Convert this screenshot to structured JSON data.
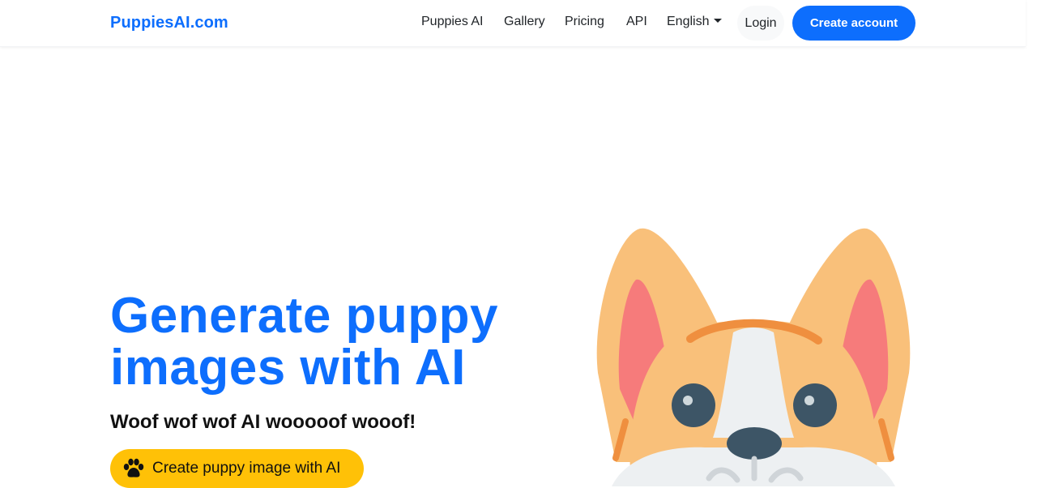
{
  "navbar": {
    "brand": "PuppiesAI.com",
    "links": [
      "Puppies AI",
      "Gallery",
      "Pricing",
      "API"
    ],
    "language": "English",
    "login_label": "Login",
    "create_account_label": "Create account"
  },
  "hero": {
    "title_line1": "Generate puppy",
    "title_line2": "images with AI",
    "subtitle": "Woof wof wof AI wooooof wooof!",
    "cta_label": "Create puppy image with AI",
    "cta_icon": "paw-icon",
    "illustration": "corgi-puppy-illustration"
  },
  "colors": {
    "accent": "#0d6efd",
    "cta": "#ffc107"
  }
}
